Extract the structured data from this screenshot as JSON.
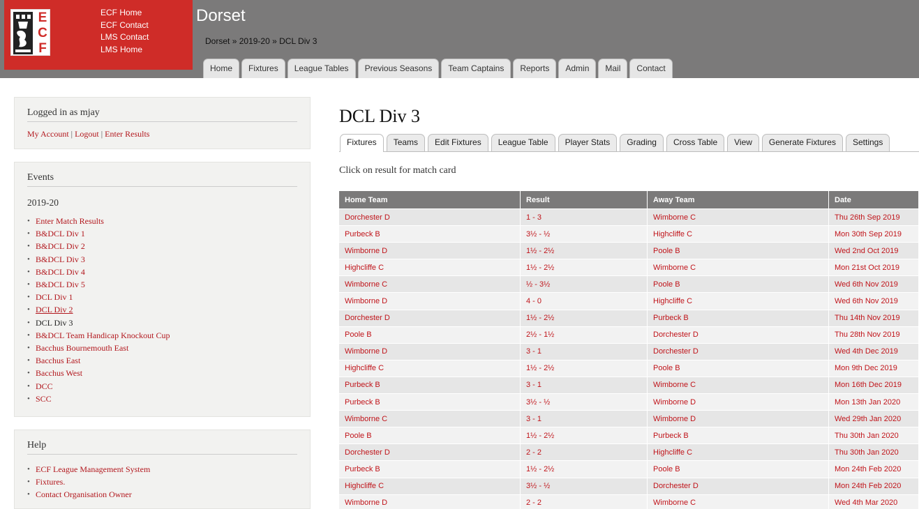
{
  "brand": {
    "logo_text": "ECF",
    "colors": {
      "brand_red": "#cf2c28",
      "header_gray": "#7b7a7a",
      "link_red": "#b2171d"
    },
    "links": [
      "ECF Home",
      "ECF Contact",
      "LMS Contact",
      "LMS Home"
    ]
  },
  "site": {
    "title": "Dorset",
    "breadcrumb": {
      "level1": "Dorset",
      "level2": "2019-20",
      "current": "DCL Div 3",
      "separator": "»"
    }
  },
  "main_nav": [
    "Home",
    "Fixtures",
    "League Tables",
    "Previous Seasons",
    "Team Captains",
    "Reports",
    "Admin",
    "Mail",
    "Contact"
  ],
  "user_block": {
    "title": "Logged in as mjay",
    "links": [
      "My Account",
      "Logout",
      "Enter Results"
    ],
    "separator": "|"
  },
  "events": {
    "title": "Events",
    "season": "2019-20",
    "items": [
      {
        "label": "Enter Match Results",
        "type": "link"
      },
      {
        "label": "B&DCL Div 1",
        "type": "link"
      },
      {
        "label": "B&DCL Div 2",
        "type": "link"
      },
      {
        "label": "B&DCL Div 3",
        "type": "link"
      },
      {
        "label": "B&DCL Div 4",
        "type": "link"
      },
      {
        "label": "B&DCL Div 5",
        "type": "link"
      },
      {
        "label": "DCL Div 1",
        "type": "link"
      },
      {
        "label": "DCL Div 2",
        "type": "hover"
      },
      {
        "label": "DCL Div 3",
        "type": "current"
      },
      {
        "label": "B&DCL Team Handicap Knockout Cup",
        "type": "link"
      },
      {
        "label": "Bacchus Bournemouth East",
        "type": "link"
      },
      {
        "label": "Bacchus East",
        "type": "link"
      },
      {
        "label": "Bacchus West",
        "type": "link"
      },
      {
        "label": "DCC",
        "type": "link"
      },
      {
        "label": "SCC",
        "type": "link"
      }
    ]
  },
  "help": {
    "title": "Help",
    "items": [
      "ECF League Management System",
      "Fixtures.",
      "Contact Organisation Owner"
    ]
  },
  "content": {
    "title": "DCL Div 3",
    "tabs": [
      "Fixtures",
      "Teams",
      "Edit Fixtures",
      "League Table",
      "Player Stats",
      "Grading",
      "Cross Table",
      "View",
      "Generate Fixtures",
      "Settings"
    ],
    "active_tab": "Fixtures",
    "hint": "Click on result for match card"
  },
  "fixtures_table": {
    "headers": [
      "Home Team",
      "Result",
      "Away Team",
      "Date"
    ],
    "rows": [
      [
        "Dorchester D",
        "1 - 3",
        "Wimborne C",
        "Thu 26th Sep 2019"
      ],
      [
        "Purbeck B",
        "3½ - ½",
        "Highcliffe C",
        "Mon 30th Sep 2019"
      ],
      [
        "Wimborne D",
        "1½ - 2½",
        "Poole B",
        "Wed 2nd Oct 2019"
      ],
      [
        "Highcliffe C",
        "1½ - 2½",
        "Wimborne C",
        "Mon 21st Oct 2019"
      ],
      [
        "Wimborne C",
        "½ - 3½",
        "Poole B",
        "Wed 6th Nov 2019"
      ],
      [
        "Wimborne D",
        "4 - 0",
        "Highcliffe C",
        "Wed 6th Nov 2019"
      ],
      [
        "Dorchester D",
        "1½ - 2½",
        "Purbeck B",
        "Thu 14th Nov 2019"
      ],
      [
        "Poole B",
        "2½ - 1½",
        "Dorchester D",
        "Thu 28th Nov 2019"
      ],
      [
        "Wimborne D",
        "3 - 1",
        "Dorchester D",
        "Wed 4th Dec 2019"
      ],
      [
        "Highcliffe C",
        "1½ - 2½",
        "Poole B",
        "Mon 9th Dec 2019"
      ],
      [
        "Purbeck B",
        "3 - 1",
        "Wimborne C",
        "Mon 16th Dec 2019"
      ],
      [
        "Purbeck B",
        "3½ - ½",
        "Wimborne D",
        "Mon 13th Jan 2020"
      ],
      [
        "Wimborne C",
        "3 - 1",
        "Wimborne D",
        "Wed 29th Jan 2020"
      ],
      [
        "Poole B",
        "1½ - 2½",
        "Purbeck B",
        "Thu 30th Jan 2020"
      ],
      [
        "Dorchester D",
        "2 - 2",
        "Highcliffe C",
        "Thu 30th Jan 2020"
      ],
      [
        "Purbeck B",
        "1½ - 2½",
        "Poole B",
        "Mon 24th Feb 2020"
      ],
      [
        "Highcliffe C",
        "3½ - ½",
        "Dorchester D",
        "Mon 24th Feb 2020"
      ],
      [
        "Wimborne D",
        "2 - 2",
        "Wimborne C",
        "Wed 4th Mar 2020"
      ]
    ]
  }
}
